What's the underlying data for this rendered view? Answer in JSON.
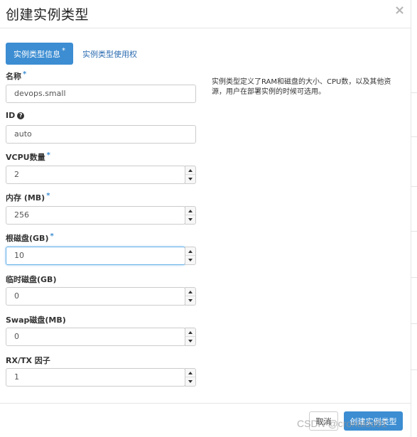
{
  "modal": {
    "title": "创建实例类型",
    "close_label": "×"
  },
  "tabs": [
    {
      "label": "实例类型信息",
      "required_mark": "*"
    },
    {
      "label": "实例类型使用权"
    }
  ],
  "form": {
    "name": {
      "label": "名称",
      "required_mark": "*",
      "value": "devops.small"
    },
    "id": {
      "label": "ID",
      "help_icon": "?",
      "value": "auto"
    },
    "vcpus": {
      "label": "VCPU数量",
      "required_mark": "*",
      "value": "2"
    },
    "memory": {
      "label": "内存 (MB)",
      "required_mark": "*",
      "value": "256"
    },
    "root_disk": {
      "label": "根磁盘(GB)",
      "required_mark": "*",
      "value": "10"
    },
    "ephemeral_disk": {
      "label": "临时磁盘(GB)",
      "value": "0"
    },
    "swap": {
      "label": "Swap磁盘(MB)",
      "value": "0"
    },
    "rxtx": {
      "label": "RX/TX 因子",
      "value": "1"
    }
  },
  "description": "实例类型定义了RAM和磁盘的大小、CPU数，以及其他资源，用户在部署实例的时候可选用。",
  "footer": {
    "cancel_label": "取消",
    "submit_label": "创建实例类型"
  },
  "watermark": "CSDN @cronaldo91",
  "colors": {
    "accent": "#3c8dd2",
    "link": "#2a6ab0",
    "focus": "#66afe9"
  }
}
